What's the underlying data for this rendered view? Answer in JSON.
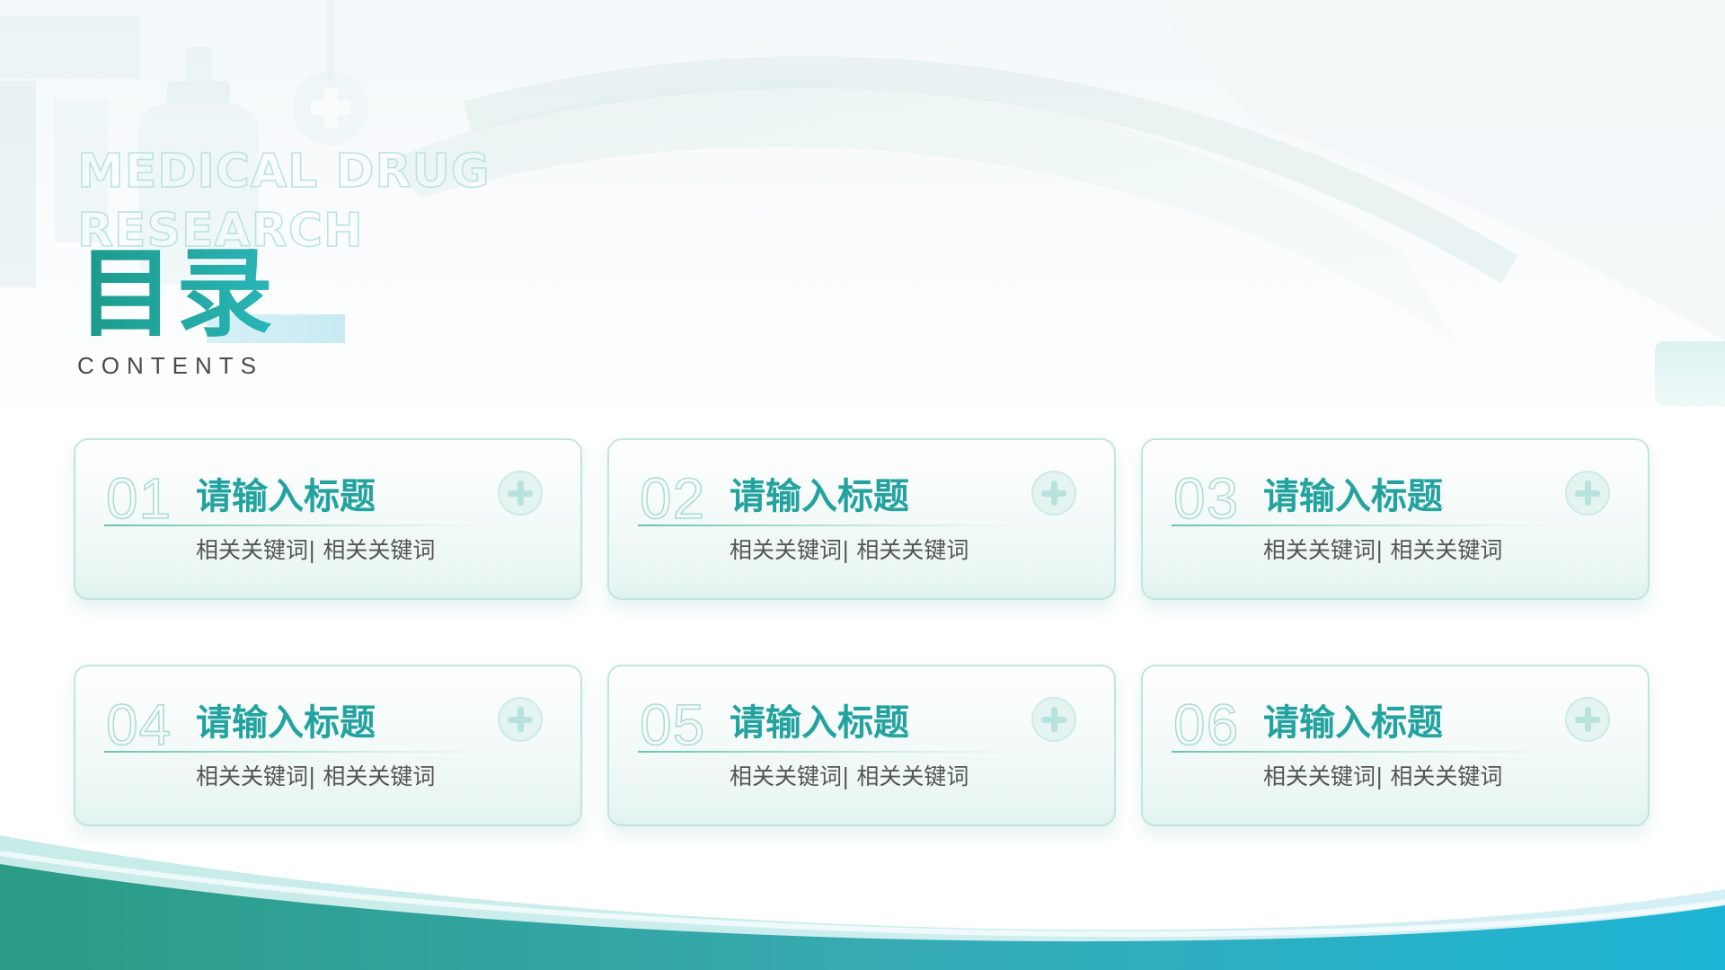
{
  "slide": {
    "watermark": "MEDICAL DRUG RESEARCH",
    "title": "目录",
    "subtitle": "CONTENTS"
  },
  "cards": [
    {
      "num": "01",
      "title": "请输入标题",
      "keywords": "相关关键词| 相关关键词"
    },
    {
      "num": "02",
      "title": "请输入标题",
      "keywords": "相关关键词| 相关关键词"
    },
    {
      "num": "03",
      "title": "请输入标题",
      "keywords": "相关关键词| 相关关键词"
    },
    {
      "num": "04",
      "title": "请输入标题",
      "keywords": "相关关键词| 相关关键词"
    },
    {
      "num": "05",
      "title": "请输入标题",
      "keywords": "相关关键词| 相关关键词"
    },
    {
      "num": "06",
      "title": "请输入标题",
      "keywords": "相关关键词| 相关关键词"
    }
  ],
  "colors": {
    "accent": "#22a3a0",
    "accent_dark": "#1c9a8a",
    "wave_left": "#2e9e8a",
    "wave_right": "#1fb3d3",
    "text_gray": "#555555"
  },
  "icons": [
    "plus-circle-icon",
    "medicine-bottle-icon",
    "medical-cross-icon"
  ]
}
